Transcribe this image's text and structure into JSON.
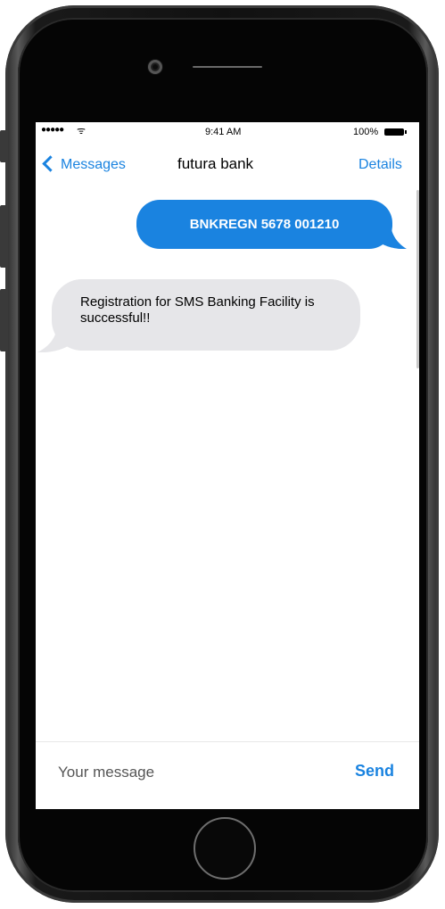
{
  "status_bar": {
    "signal": "●●●●●",
    "wifi": "ᯤ",
    "time": "9:41 AM",
    "battery": "100%"
  },
  "nav": {
    "back_label": "Messages",
    "contact": "futura bank",
    "details_label": "Details"
  },
  "messages": [
    {
      "direction": "sent",
      "text": "BNKREGN 5678 001210"
    },
    {
      "direction": "received",
      "text": "Registration for SMS Banking Facility is successful!!"
    }
  ],
  "composer": {
    "placeholder": "Your message",
    "send_label": "Send"
  },
  "colors": {
    "accent": "#1a83e0",
    "received_bubble": "#e6e6e9",
    "phone_body": "#050505"
  }
}
